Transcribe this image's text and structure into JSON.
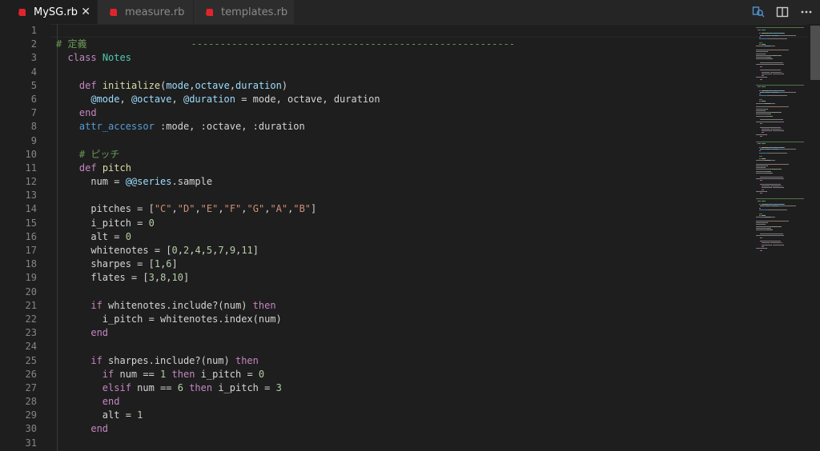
{
  "tabs": [
    {
      "label": "MySG.rb",
      "active": true,
      "close": "✕"
    },
    {
      "label": "measure.rb",
      "active": false
    },
    {
      "label": "templates.rb",
      "active": false
    }
  ],
  "toolbar": {
    "icons": [
      "compare-changes-icon",
      "split-editor-icon",
      "more-actions-icon"
    ]
  },
  "colors": {
    "keyword": "#c586c0",
    "class_name": "#4ec9b0",
    "function": "#dcdcaa",
    "param": "#9cdcfe",
    "number": "#b5cea8",
    "string": "#ce9178",
    "comment": "#6a9955",
    "builtin": "#569cd6",
    "ruby_icon": "#e0242b"
  },
  "editor": {
    "line_numbers": [
      "1",
      "2",
      "3",
      "4",
      "5",
      "6",
      "7",
      "8",
      "9",
      "10",
      "11",
      "12",
      "13",
      "14",
      "15",
      "16",
      "17",
      "18",
      "19",
      "20",
      "21",
      "22",
      "23",
      "24",
      "25",
      "26",
      "27",
      "28",
      "29",
      "30",
      "31"
    ],
    "lines": [
      [],
      [
        [
          "cm",
          "# 定義                  --------------------------------------------------------"
        ]
      ],
      [
        [
          "tx",
          "  "
        ],
        [
          "kw",
          "class"
        ],
        [
          "tx",
          " "
        ],
        [
          "cls",
          "Notes"
        ]
      ],
      [],
      [
        [
          "tx",
          "    "
        ],
        [
          "kw",
          "def"
        ],
        [
          "tx",
          " "
        ],
        [
          "fn",
          "initialize"
        ],
        [
          "tx",
          "("
        ],
        [
          "pr",
          "mode"
        ],
        [
          "tx",
          ","
        ],
        [
          "pr",
          "octave"
        ],
        [
          "tx",
          ","
        ],
        [
          "pr",
          "duration"
        ],
        [
          "tx",
          ")"
        ]
      ],
      [
        [
          "tx",
          "      "
        ],
        [
          "pr",
          "@mode"
        ],
        [
          "tx",
          ", "
        ],
        [
          "pr",
          "@octave"
        ],
        [
          "tx",
          ", "
        ],
        [
          "pr",
          "@duration"
        ],
        [
          "tx",
          " = mode, octave, duration"
        ]
      ],
      [
        [
          "tx",
          "    "
        ],
        [
          "kw",
          "end"
        ]
      ],
      [
        [
          "tx",
          "    "
        ],
        [
          "bl",
          "attr_accessor"
        ],
        [
          "tx",
          " :mode, :octave, :duration"
        ]
      ],
      [],
      [
        [
          "tx",
          "    "
        ],
        [
          "cm",
          "# ピッチ"
        ]
      ],
      [
        [
          "tx",
          "    "
        ],
        [
          "kw",
          "def"
        ],
        [
          "tx",
          " "
        ],
        [
          "fn",
          "pitch"
        ]
      ],
      [
        [
          "tx",
          "      num = "
        ],
        [
          "pr",
          "@@series"
        ],
        [
          "tx",
          ".sample"
        ]
      ],
      [],
      [
        [
          "tx",
          "      pitches = ["
        ],
        [
          "st",
          "\"C\""
        ],
        [
          "tx",
          ","
        ],
        [
          "st",
          "\"D\""
        ],
        [
          "tx",
          ","
        ],
        [
          "st",
          "\"E\""
        ],
        [
          "tx",
          ","
        ],
        [
          "st",
          "\"F\""
        ],
        [
          "tx",
          ","
        ],
        [
          "st",
          "\"G\""
        ],
        [
          "tx",
          ","
        ],
        [
          "st",
          "\"A\""
        ],
        [
          "tx",
          ","
        ],
        [
          "st",
          "\"B\""
        ],
        [
          "tx",
          "]"
        ]
      ],
      [
        [
          "tx",
          "      i_pitch = "
        ],
        [
          "nm",
          "0"
        ]
      ],
      [
        [
          "tx",
          "      alt = "
        ],
        [
          "nm",
          "0"
        ]
      ],
      [
        [
          "tx",
          "      whitenotes = ["
        ],
        [
          "nm",
          "0"
        ],
        [
          "tx",
          ","
        ],
        [
          "nm",
          "2"
        ],
        [
          "tx",
          ","
        ],
        [
          "nm",
          "4"
        ],
        [
          "tx",
          ","
        ],
        [
          "nm",
          "5"
        ],
        [
          "tx",
          ","
        ],
        [
          "nm",
          "7"
        ],
        [
          "tx",
          ","
        ],
        [
          "nm",
          "9"
        ],
        [
          "tx",
          ","
        ],
        [
          "nm",
          "11"
        ],
        [
          "tx",
          "]"
        ]
      ],
      [
        [
          "tx",
          "      sharpes = ["
        ],
        [
          "nm",
          "1"
        ],
        [
          "tx",
          ","
        ],
        [
          "nm",
          "6"
        ],
        [
          "tx",
          "]"
        ]
      ],
      [
        [
          "tx",
          "      flates = ["
        ],
        [
          "nm",
          "3"
        ],
        [
          "tx",
          ","
        ],
        [
          "nm",
          "8"
        ],
        [
          "tx",
          ","
        ],
        [
          "nm",
          "10"
        ],
        [
          "tx",
          "]"
        ]
      ],
      [],
      [
        [
          "tx",
          "      "
        ],
        [
          "kw",
          "if"
        ],
        [
          "tx",
          " whitenotes.include?(num) "
        ],
        [
          "kw",
          "then"
        ]
      ],
      [
        [
          "tx",
          "        i_pitch = whitenotes.index(num)"
        ]
      ],
      [
        [
          "tx",
          "      "
        ],
        [
          "kw",
          "end"
        ]
      ],
      [],
      [
        [
          "tx",
          "      "
        ],
        [
          "kw",
          "if"
        ],
        [
          "tx",
          " sharpes.include?(num) "
        ],
        [
          "kw",
          "then"
        ]
      ],
      [
        [
          "tx",
          "        "
        ],
        [
          "kw",
          "if"
        ],
        [
          "tx",
          " num == "
        ],
        [
          "nm",
          "1"
        ],
        [
          "tx",
          " "
        ],
        [
          "kw",
          "then"
        ],
        [
          "tx",
          " i_pitch = "
        ],
        [
          "nm",
          "0"
        ]
      ],
      [
        [
          "tx",
          "        "
        ],
        [
          "kw",
          "elsif"
        ],
        [
          "tx",
          " num == "
        ],
        [
          "nm",
          "6"
        ],
        [
          "tx",
          " "
        ],
        [
          "kw",
          "then"
        ],
        [
          "tx",
          " i_pitch = "
        ],
        [
          "nm",
          "3"
        ]
      ],
      [
        [
          "tx",
          "        "
        ],
        [
          "kw",
          "end"
        ]
      ],
      [
        [
          "tx",
          "        alt = "
        ],
        [
          "nm",
          "1"
        ]
      ],
      [
        [
          "tx",
          "      "
        ],
        [
          "kw",
          "end"
        ]
      ],
      []
    ]
  }
}
